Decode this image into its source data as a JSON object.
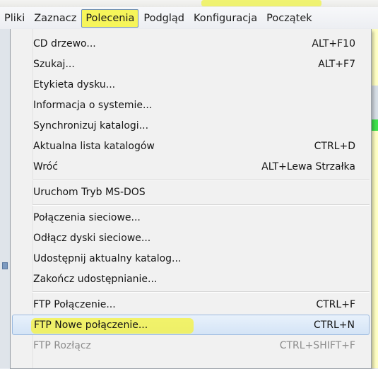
{
  "menubar": {
    "items": [
      "Pliki",
      "Zaznacz",
      "Polecenia",
      "Podgląd",
      "Konfiguracja",
      "Początek"
    ],
    "active_index": 2,
    "highlight_color": "#f6f55a"
  },
  "menu": {
    "groups": [
      [
        {
          "label": "CD drzewo...",
          "shortcut": "ALT+F10"
        },
        {
          "label": "Szukaj...",
          "shortcut": "ALT+F7"
        },
        {
          "label": "Etykieta dysku...",
          "shortcut": ""
        },
        {
          "label": "Informacja o systemie...",
          "shortcut": ""
        },
        {
          "label": "Synchronizuj katalogi...",
          "shortcut": ""
        },
        {
          "label": "Aktualna lista katalogów",
          "shortcut": "CTRL+D"
        },
        {
          "label": "Wróć",
          "shortcut": "ALT+Lewa Strzałka"
        }
      ],
      [
        {
          "label": "Uruchom Tryb MS-DOS",
          "shortcut": ""
        }
      ],
      [
        {
          "label": "Połączenia sieciowe...",
          "shortcut": ""
        },
        {
          "label": "Odłącz dyski sieciowe...",
          "shortcut": ""
        },
        {
          "label": "Udostępnij aktualny katalog...",
          "shortcut": ""
        },
        {
          "label": "Zakończ udostępnianie...",
          "shortcut": ""
        }
      ],
      [
        {
          "label": "FTP Połączenie...",
          "shortcut": "CTRL+F"
        },
        {
          "label": "FTP Nowe połączenie...",
          "shortcut": "CTRL+N",
          "state": "hovered"
        },
        {
          "label": "FTP Rozłącz",
          "shortcut": "CTRL+SHIFT+F",
          "state": "disabled"
        }
      ]
    ]
  },
  "colors": {
    "hover_bg": "#d4e4f6",
    "marker_yellow": "#f5f33a",
    "menu_bg": "#f1f1f1"
  }
}
